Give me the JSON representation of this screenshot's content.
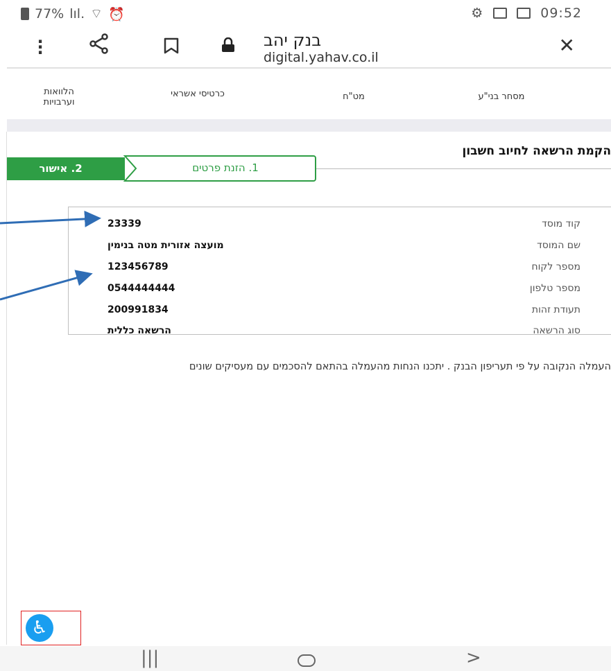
{
  "status_bar": {
    "battery": "77%",
    "time": "09:52"
  },
  "toolbar": {
    "title": "בנק יהב",
    "url": "digital.yahav.co.il"
  },
  "nav": {
    "items": [
      {
        "label": "מסחר בני\"ע"
      },
      {
        "label": "מט\"ח"
      },
      {
        "label": "כרטיסי אשראי"
      },
      {
        "label": "הלוואות\nוערבויות"
      }
    ]
  },
  "page": {
    "title": "הקמת הרשאה לחיוב חשבון",
    "steps": [
      {
        "label": "1. הזנת פרטים",
        "state": "current"
      },
      {
        "label": "2. אישור",
        "state": "active"
      }
    ]
  },
  "details": {
    "rows": [
      {
        "label": "קוד מוסד",
        "value": "23339"
      },
      {
        "label": "שם המוסד",
        "value": "מועצה אזורית מטה בנימין"
      },
      {
        "label": "מספר לקוח",
        "value": "123456789"
      },
      {
        "label": "מספר טלפון",
        "value": "0544444444"
      },
      {
        "label": "תעודת זהות",
        "value": "200991834"
      },
      {
        "label": "סוג הרשאה",
        "value": "הרשאה כללית"
      }
    ]
  },
  "note": "העמלה הנקובה על פי תעריפון הבנק . יתכנו הנחות מהעמלה בהתאם להסכמים עם מעסיקים שונים",
  "colors": {
    "accent_green": "#2e9e45",
    "accessibility_blue": "#1a9ef0",
    "annotation_arrow": "#2f6db5"
  }
}
